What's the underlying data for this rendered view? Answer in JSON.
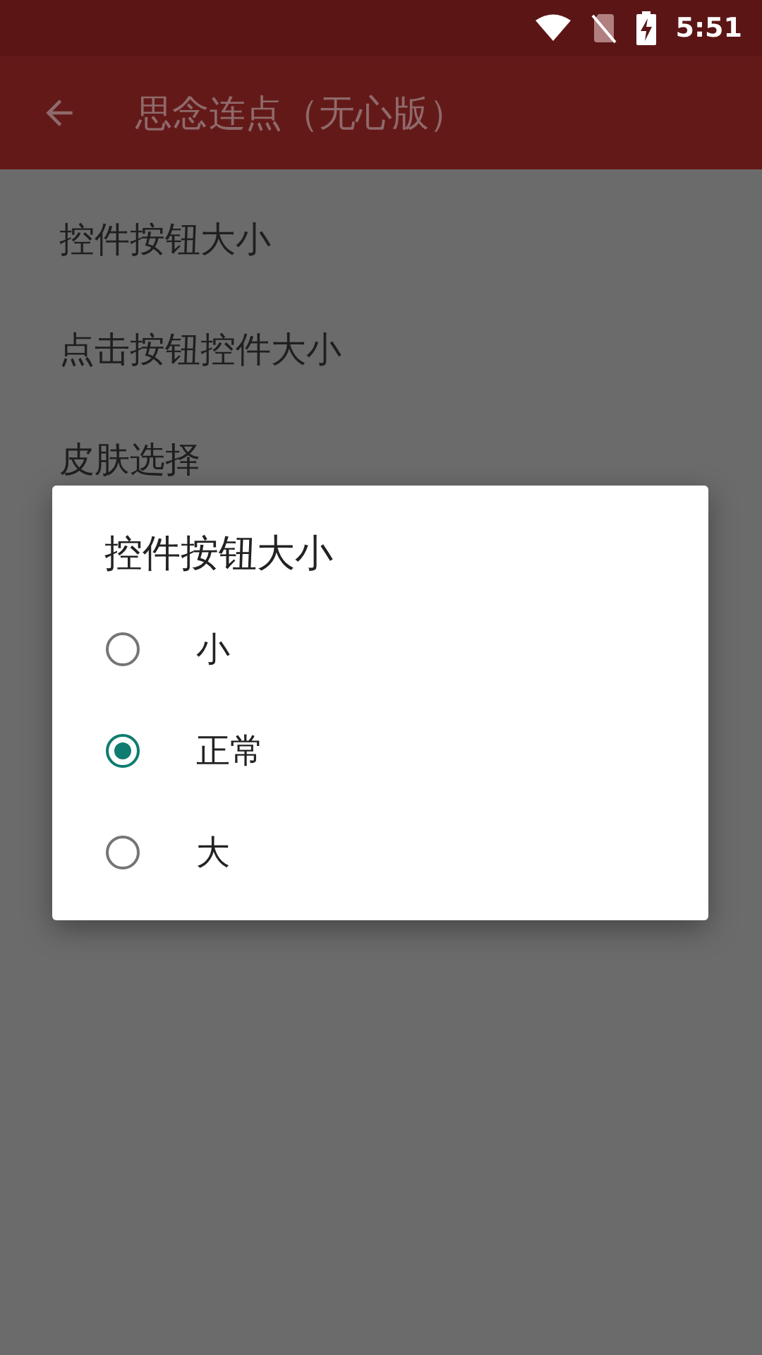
{
  "status_bar": {
    "time": "5:51"
  },
  "app_bar": {
    "title": "思念连点（无心版）"
  },
  "settings": [
    {
      "label": "控件按钮大小"
    },
    {
      "label": "点击按钮控件大小"
    },
    {
      "label": "皮肤选择"
    }
  ],
  "dialog": {
    "title": "控件按钮大小",
    "options": [
      {
        "label": "小",
        "selected": false
      },
      {
        "label": "正常",
        "selected": true
      },
      {
        "label": "大",
        "selected": false
      }
    ]
  }
}
